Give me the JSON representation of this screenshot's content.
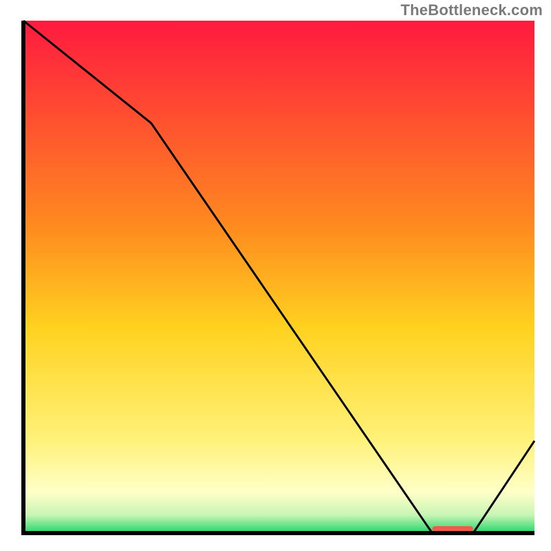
{
  "watermark": "TheBottleneck.com",
  "chart_data": {
    "type": "line",
    "title": "",
    "xlabel": "",
    "ylabel": "",
    "xlim": [
      0,
      100
    ],
    "ylim": [
      0,
      100
    ],
    "x": [
      0,
      25,
      80,
      88,
      100
    ],
    "values": [
      100,
      80,
      0,
      0,
      18
    ],
    "marker": {
      "label": "",
      "x_start": 80,
      "x_end": 88,
      "color": "#f45a4a"
    },
    "gradient_stops": [
      {
        "offset": 0.0,
        "color": "#ff1a3f"
      },
      {
        "offset": 0.4,
        "color": "#ff8a1f"
      },
      {
        "offset": 0.6,
        "color": "#ffd21f"
      },
      {
        "offset": 0.82,
        "color": "#fff27a"
      },
      {
        "offset": 0.92,
        "color": "#ffffc8"
      },
      {
        "offset": 0.965,
        "color": "#c8f5b4"
      },
      {
        "offset": 1.0,
        "color": "#1fd66a"
      }
    ],
    "axis_color": "#000000",
    "line_color": "#000000"
  }
}
